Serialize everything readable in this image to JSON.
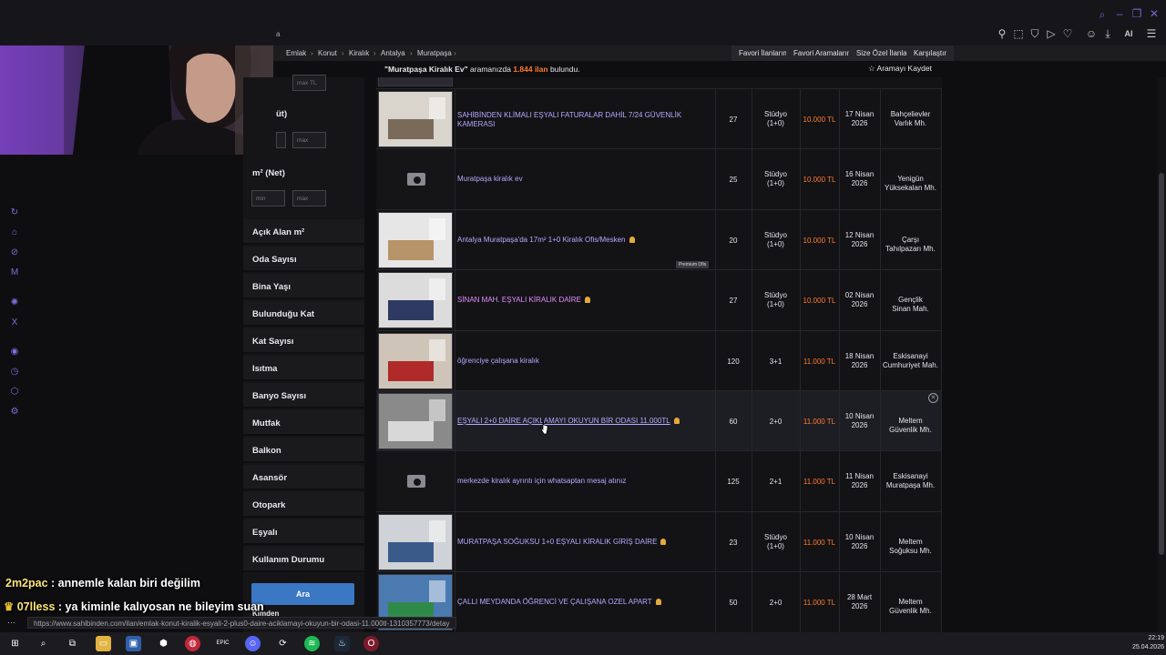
{
  "browser": {
    "tab_fragment": "a",
    "toolbar_icons": [
      "search-icon",
      "minimize-icon",
      "maximize-icon",
      "close-icon"
    ],
    "ext_ai_label": "AI"
  },
  "breadcrumb": [
    "Emlak",
    "Konut",
    "Kiralık",
    "Antalya",
    "Muratpaşa"
  ],
  "right_tabs": [
    "Favori İlanlarım",
    "Favori Aramalarım",
    "Size Özel İlanlar",
    "Karşılaştır"
  ],
  "result": {
    "query": "\"Muratpaşa Kiralık Ev\"",
    "middle": " aramanızda ",
    "count": "1.844 ilan",
    "suffix": " bulundu.",
    "save_search": "Aramayı Kaydet"
  },
  "sidebar": {
    "max_tl": "max TL",
    "partial_label": "üt)",
    "min": "min",
    "max": "max",
    "m2_label": "m² (Net)",
    "filters": [
      "Açık Alan m²",
      "Oda Sayısı",
      "Bina Yaşı",
      "Bulunduğu Kat",
      "Kat Sayısı",
      "Isıtma",
      "Banyo Sayısı",
      "Mutfak",
      "Balkon",
      "Asansör",
      "Otopark",
      "Eşyalı",
      "Kullanım Durumu"
    ],
    "partial_bottom": "Kimden",
    "search_button": "Ara"
  },
  "listings": [
    {
      "title": "SAHİBİNDEN KLİMALI EŞYALI FATURALAR DAHİL 7/24 GÜVENLİK KAMERASI",
      "m2": "27",
      "rooms": "Stüdyo (1+0)",
      "price": "10.000 TL",
      "date": "17 Nisan 2026",
      "location": "Bahçelievler Varlık Mh.",
      "photo": true,
      "pin": false
    },
    {
      "title": "Muratpaşa kiralık ev",
      "m2": "25",
      "rooms": "Stüdyo (1+0)",
      "price": "10.000 TL",
      "date": "16 Nisan 2026",
      "location": "Yenigün Yüksekalan Mh.",
      "photo": false,
      "pin": false
    },
    {
      "title": "Antalya Muratpaşa'da 17m² 1+0 Kiralık Ofis/Mesken",
      "m2": "20",
      "rooms": "Stüdyo (1+0)",
      "price": "10.000 TL",
      "date": "12 Nisan 2026",
      "location": "Çarşı Tahılpazarı Mh.",
      "photo": true,
      "pin": true,
      "badge": "Premium Ofis"
    },
    {
      "title": "SİNAN MAH. EŞYALI KİRALIK DAİRE",
      "m2": "27",
      "rooms": "Stüdyo (1+0)",
      "price": "10.000 TL",
      "date": "02 Nisan 2026",
      "location": "Gençlik Sinan Mah.",
      "photo": true,
      "pin": true,
      "pink": true
    },
    {
      "title": "öğrenciye çalışana kiralık",
      "m2": "120",
      "rooms": "3+1",
      "price": "11.000 TL",
      "date": "18 Nisan 2026",
      "location": "Eskisanayi Cumhuriyet Mah.",
      "photo": true,
      "pin": false
    },
    {
      "title": "EŞYALI 2+0 DAİRE AÇIKLAMAYI OKUYUN BİR ODASI 11.000TL",
      "m2": "60",
      "rooms": "2+0",
      "price": "11.000 TL",
      "date": "10 Nisan 2026",
      "location": "Meltem Güvenlik Mh.",
      "photo": true,
      "pin": true,
      "highlight": true
    },
    {
      "title": "merkezde kiralık ayrıntı için whatsaptan mesaj atınız",
      "m2": "125",
      "rooms": "2+1",
      "price": "11.000 TL",
      "date": "11 Nisan 2026",
      "location": "Eskisanayi Muratpaşa Mh.",
      "photo": false,
      "pin": false
    },
    {
      "title": "MURATPAŞA SOĞUKSU 1+0 EŞYALI KİRALIK GİRİŞ DAİRE",
      "m2": "23",
      "rooms": "Stüdyo (1+0)",
      "price": "11.000 TL",
      "date": "10 Nisan 2026",
      "location": "Meltem Soğuksu Mh.",
      "photo": true,
      "pin": true
    },
    {
      "title": "ÇALLI MEYDANDA ÖĞRENCİ VE ÇALIŞANA OZEL APART",
      "m2": "50",
      "rooms": "2+0",
      "price": "11.000 TL",
      "date": "28 Mart 2026",
      "location": "Meltem Güvenlik Mh.",
      "photo": true,
      "pin": true
    }
  ],
  "chat": [
    {
      "user": "2m2pac",
      "message": " : annemle kalan biri değilim"
    },
    {
      "user": "07lless",
      "message": " : ya kiminle kalıyosan ne bileyim suan"
    }
  ],
  "status_url": "https://www.sahibinden.com/ilan/emlak-konut-kiralik-esyali-2-plus0-daire-aciklamayi-okuyun-bir-odasi-11.000tl-1310357773/detay",
  "clock": {
    "time": "22:19",
    "date": "25.04.2026"
  },
  "colors": {
    "price": "#ff7a30",
    "link": "#b7a9ff",
    "accent": "#7a6fe0",
    "button": "#3b78c4"
  }
}
